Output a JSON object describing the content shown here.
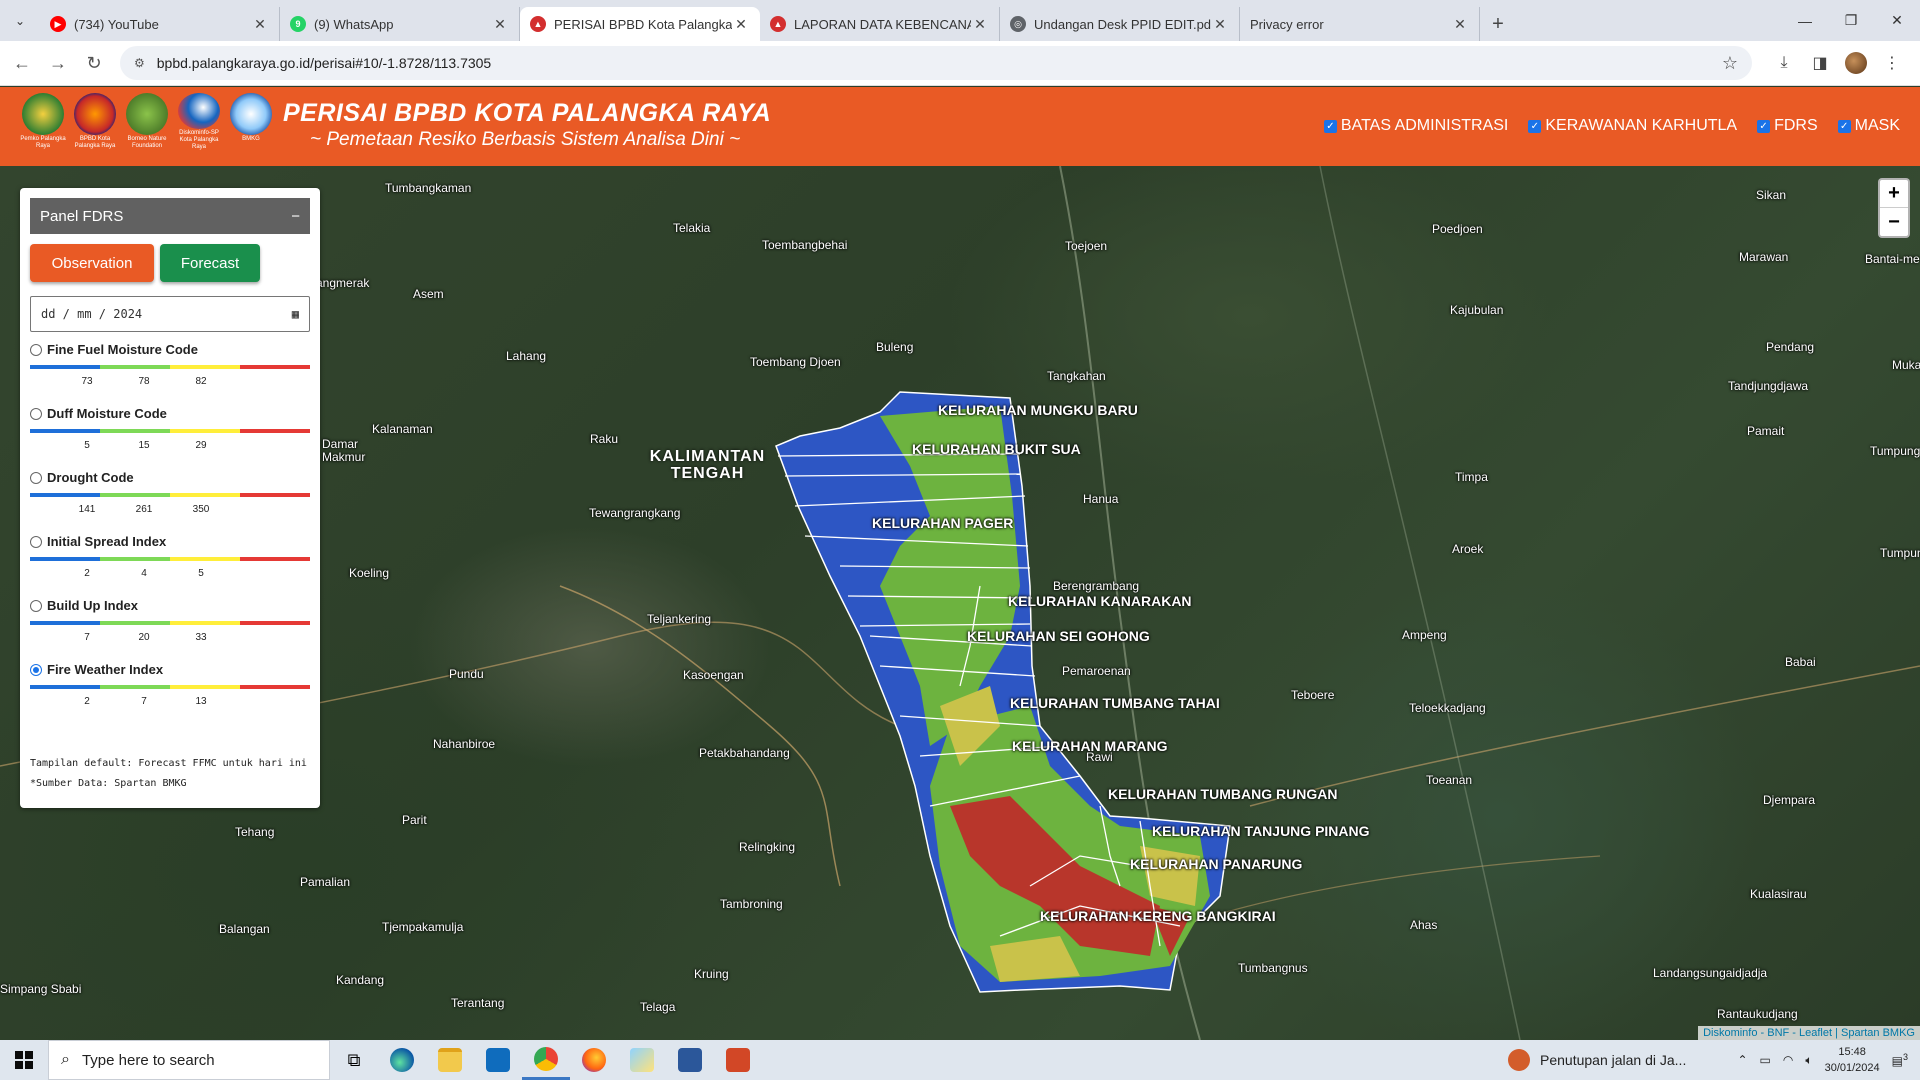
{
  "browser": {
    "tabs": [
      {
        "title": "(734) YouTube",
        "icon": "youtube-icon",
        "color": "#ff0000",
        "active": false
      },
      {
        "title": "(9) WhatsApp",
        "icon": "whatsapp-icon",
        "color": "#25d366",
        "active": false
      },
      {
        "title": "PERISAI BPBD Kota Palangka Ra",
        "icon": "bpbd-icon",
        "color": "#d32f2f",
        "active": true
      },
      {
        "title": "LAPORAN DATA KEBENCANAAN",
        "icon": "bpbd-icon",
        "color": "#d32f2f",
        "active": false
      },
      {
        "title": "Undangan Desk PPID EDIT.pdf",
        "icon": "globe-icon",
        "color": "#5f6368",
        "active": false
      },
      {
        "title": "Privacy error",
        "icon": "warning-icon",
        "color": "#5f6368",
        "active": false
      }
    ],
    "url": "bpbd.palangkaraya.go.id/perisai#10/-1.8728/113.7305"
  },
  "header": {
    "logos": [
      {
        "caption": "Pemko Palangka Raya",
        "color": "#2e7d32"
      },
      {
        "caption": "BPBD Kota Palangka Raya",
        "color": "#c62828"
      },
      {
        "caption": "Borneo Nature Foundation",
        "color": "#4e7d2a"
      },
      {
        "caption": "Diskominfo-SP Kota Palangka Raya",
        "color": "#1565c0"
      },
      {
        "caption": "BMKG",
        "color": "#0d47a1"
      }
    ],
    "title": "PERISAI BPBD KOTA PALANGKA RAYA",
    "subtitle": "~ Pemetaan Resiko Berbasis Sistem Analisa Dini ~",
    "layers": [
      "BATAS ADMINISTRASI",
      "KERAWANAN KARHUTLA",
      "FDRS",
      "MASK"
    ]
  },
  "panel": {
    "title": "Panel FDRS",
    "collapse": "−",
    "observation": "Observation",
    "forecast": "Forecast",
    "date_value": "dd / mm / 2024",
    "scale_colors": [
      "#1e6fd9",
      "#7ed957",
      "#ffee3a",
      "#e53935"
    ],
    "indices": [
      {
        "label": "Fine Fuel Moisture Code",
        "ticks": [
          "73",
          "78",
          "82"
        ],
        "selected": false
      },
      {
        "label": "Duff Moisture Code",
        "ticks": [
          "5",
          "15",
          "29"
        ],
        "selected": false
      },
      {
        "label": "Drought Code",
        "ticks": [
          "141",
          "261",
          "350"
        ],
        "selected": false
      },
      {
        "label": "Initial Spread Index",
        "ticks": [
          "2",
          "4",
          "5"
        ],
        "selected": false
      },
      {
        "label": "Build Up Index",
        "ticks": [
          "7",
          "20",
          "33"
        ],
        "selected": false
      },
      {
        "label": "Fire Weather Index",
        "ticks": [
          "2",
          "7",
          "13"
        ],
        "selected": true
      }
    ],
    "note_default": "Tampilan default: Forecast FFMC untuk hari ini",
    "note_source": "*Sumber Data: Spartan BMKG"
  },
  "map": {
    "province": "KALIMANTAN TENGAH",
    "places": [
      "Tumbangkaman",
      "Telakia",
      "Toembangbehai",
      "Toejoen",
      "Poedjoen",
      "Sikan",
      "Marawan",
      "Bantai-me",
      "angmerak",
      "Asem",
      "Kajubulan",
      "Lahang",
      "Buleng",
      "Toembang Djoen",
      "Tangkahan",
      "Pendang",
      "Tandjungdjawa",
      "Muka",
      "Damar Makmur",
      "Kalanaman",
      "Raku",
      "Pamait",
      "Tumpunga",
      "Hanua",
      "Timpa",
      "Tewangrangkang",
      "Aroek",
      "Tumpung",
      "Koeling",
      "Berengrambang",
      "Teljankering",
      "Ampeng",
      "Babai",
      "Pundu",
      "Kasoengan",
      "Pemaroenan",
      "Teboere",
      "Teloekkadjang",
      "Nahanbiroe",
      "Petakbahandang",
      "Rawi",
      "Toeanan",
      "Djempara",
      "Parit",
      "Tehang",
      "Relingking",
      "Pamalian",
      "Tambroning",
      "Kualasirau",
      "Balangan",
      "Tjempakamulja",
      "Ahas",
      "Kandang",
      "Kruing",
      "Tumbangnus",
      "Landangsungaidjadja",
      "Simpang Sbabi",
      "Terantang",
      "Telaga",
      "Rantaukudjang"
    ],
    "kelurahan": [
      "KELURAHAN MUNGKU BARU",
      "KELURAHAN BUKIT SUA",
      "KELURAHAN PAGER",
      "KELURAHAN KANARAKAN",
      "KELURAHAN SEI GOHONG",
      "KELURAHAN TUMBANG TAHAI",
      "KELURAHAN MARANG",
      "KELURAHAN TUMBANG RUNGAN",
      "KELURAHAN TANJUNG PINANG",
      "KELURAHAN PANARUNG",
      "KELURAHAN KERENG BANGKIRAI"
    ],
    "zoom_in": "+",
    "zoom_out": "−",
    "attribution": "Diskominfo - BNF - Leaflet | Spartan BMKG",
    "fill_colors": {
      "low": "#2d56c4",
      "moderate": "#6db33f",
      "high": "#c9c24a",
      "extreme": "#b8362b"
    }
  },
  "taskbar": {
    "search_placeholder": "Type here to search",
    "news": "Penutupan jalan di Ja...",
    "time": "15:48",
    "date": "30/01/2024",
    "notif_count": "3"
  }
}
